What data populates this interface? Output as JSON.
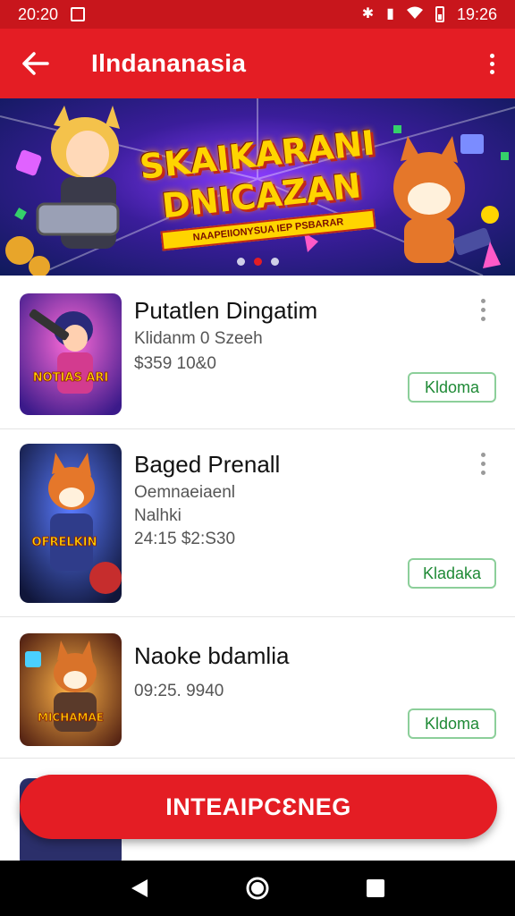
{
  "status_bar": {
    "time": "20:20",
    "clock": "19:26",
    "icons": [
      "box-icon",
      "bluetooth-icon",
      "nfc-icon",
      "wifi-icon",
      "battery-icon"
    ]
  },
  "app_bar": {
    "title": "Ilndananasia",
    "back_icon": "arrow-left-icon",
    "menu_icon": "more-vert-icon"
  },
  "banner": {
    "title_line1": "SKAIKARANI",
    "title_line2": "DNICAZAN",
    "ribbon": "NAAPEIIONYSUA IEP PSBARAR",
    "dots": 3,
    "active_dot": 1
  },
  "games": [
    {
      "name": "Putatlen Dingatim",
      "meta": [
        "Klidanm 0 Szeeh",
        "$359 10&0"
      ],
      "thumb_label": "NOTIAS ARI",
      "action": "Kldoma"
    },
    {
      "name": "Baged Prenall",
      "meta": [
        "Oemnaeiaenl",
        "Nalhki",
        "24:15  $2:S30"
      ],
      "thumb_label": "OFRELKIN",
      "action": "Kladaka"
    },
    {
      "name": "Naoke bdamlia",
      "meta": [
        "09:25. 9940"
      ],
      "thumb_label": "MICHAMAE",
      "action": "Kldoma"
    }
  ],
  "fab": {
    "label": "INTEAIPCƐNEG"
  },
  "nav": {
    "icons": [
      "back-triangle-icon",
      "home-circle-icon",
      "recents-square-icon"
    ]
  },
  "colors": {
    "primary": "#e41d24",
    "status": "#c8161c",
    "action_border": "#8ccf9a",
    "action_text": "#1f8a36"
  }
}
